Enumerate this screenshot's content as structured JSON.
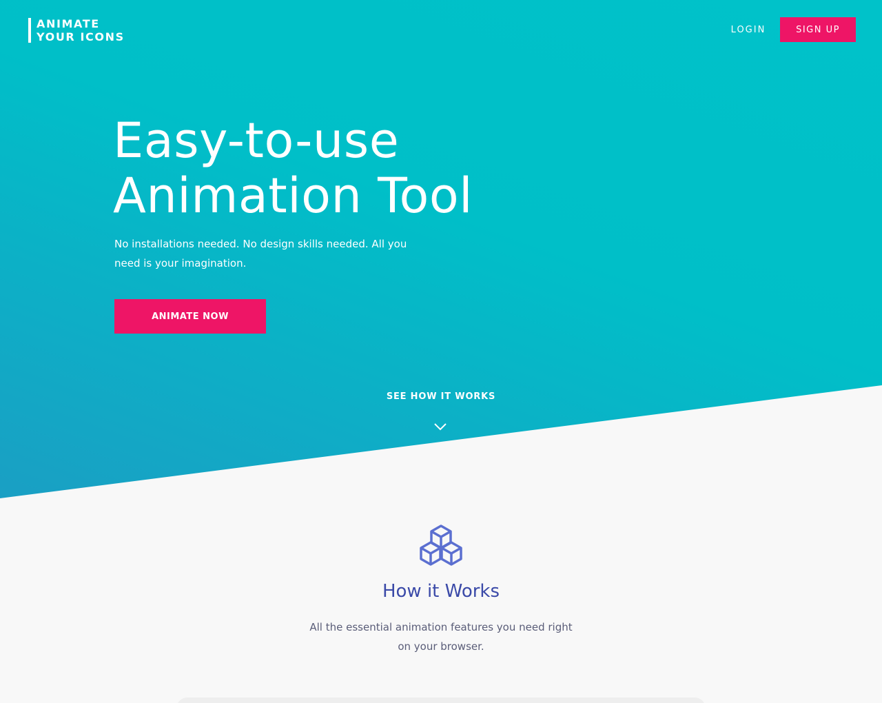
{
  "brand": {
    "line1": "ANIMATE",
    "line2": "YOUR ICONS"
  },
  "nav": {
    "login": "LOGIN",
    "signup": "SIGN UP"
  },
  "hero": {
    "title_line1": "Easy-to-use",
    "title_line2": "Animation Tool",
    "subtitle": "No installations needed. No design skills needed. All you need is your imagination.",
    "cta": "ANIMATE NOW",
    "see_how": "SEE HOW IT WORKS"
  },
  "how_it_works": {
    "title": "How it Works",
    "subtitle": "All the essential animation features you need right on your browser."
  },
  "colors": {
    "teal": "#00c2c9",
    "accent_pink": "#ee1566",
    "heading_blue": "#3b4aa8",
    "icon_blue": "#5b6fd0"
  },
  "icons": {
    "chevron": "chevron-down-icon",
    "feature": "cubes-icon"
  }
}
